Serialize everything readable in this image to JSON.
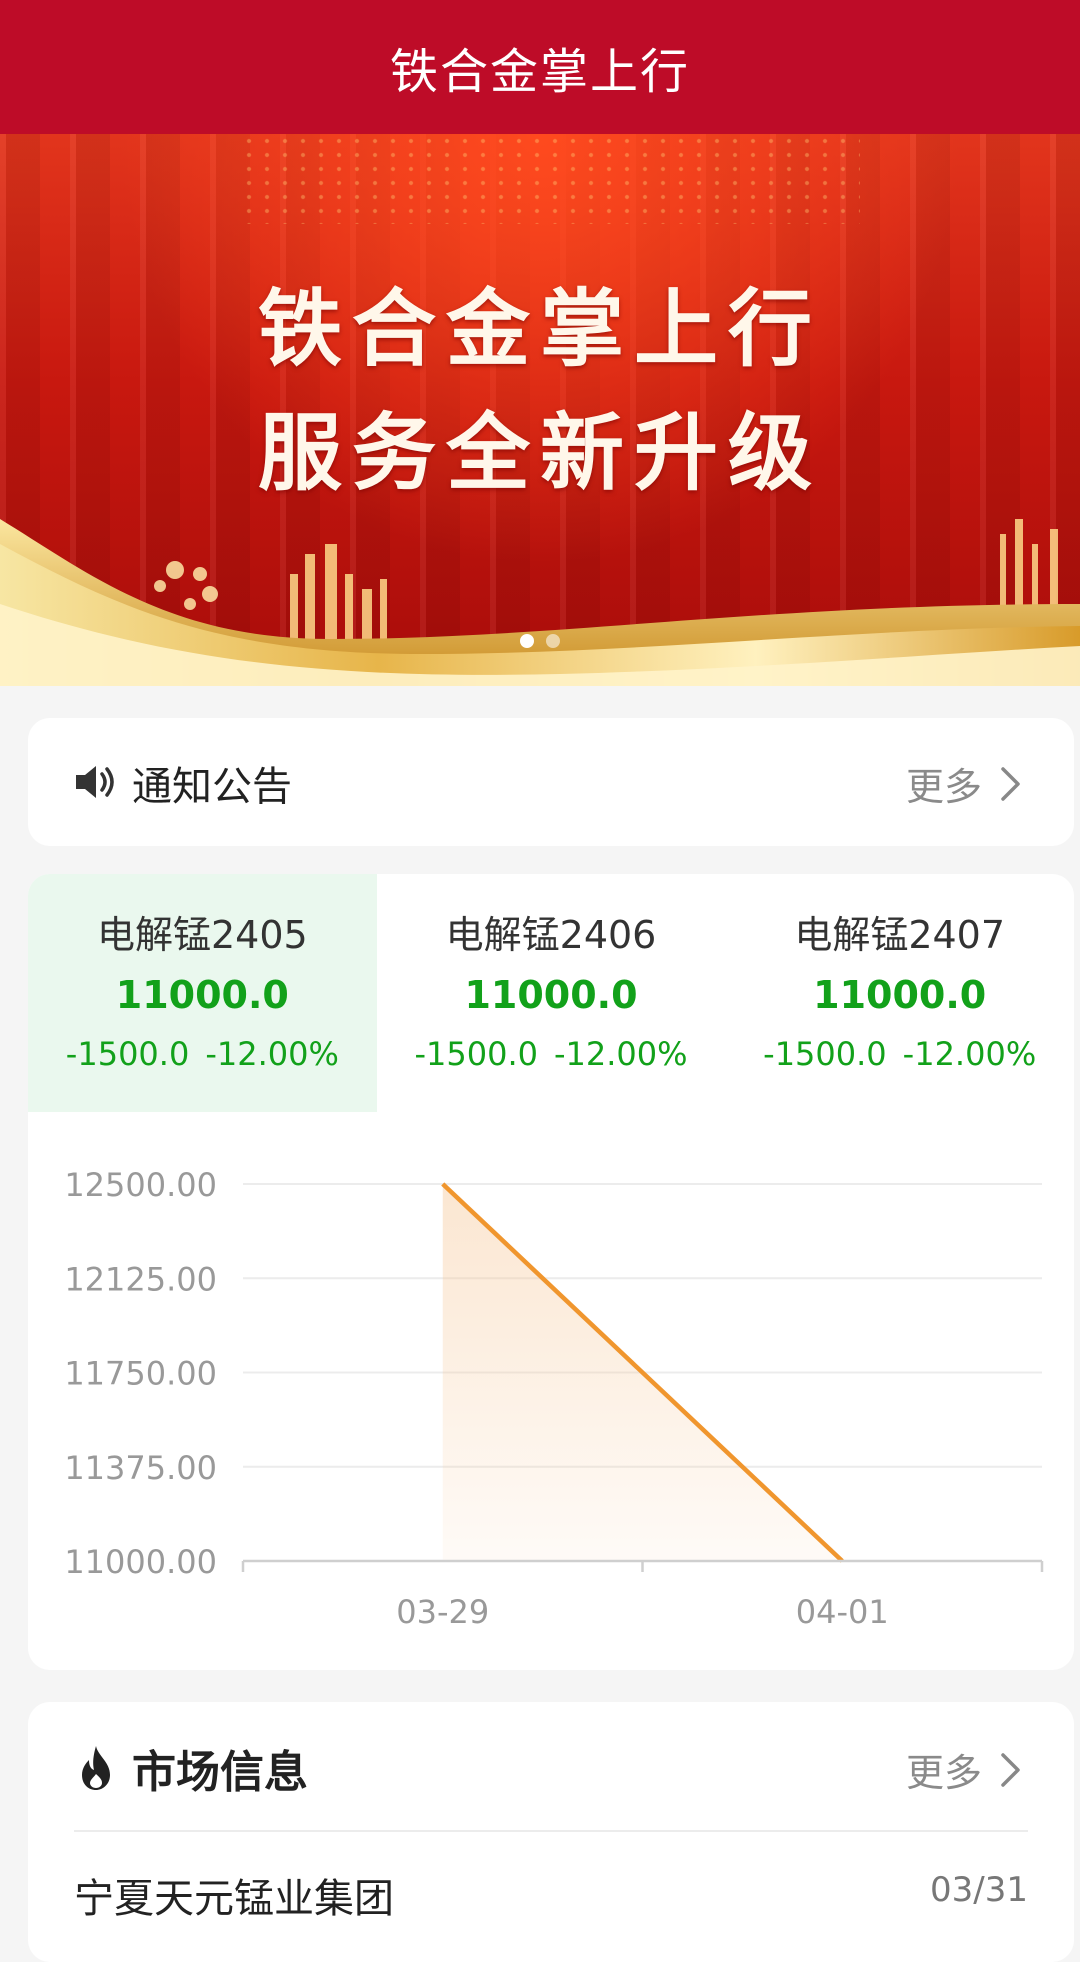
{
  "header": {
    "title": "铁合金掌上行"
  },
  "banner": {
    "line1": "铁合金掌上行",
    "line2": "服务全新升级",
    "slide_count": 2,
    "active_slide": 1
  },
  "notice": {
    "icon": "speaker-icon",
    "title": "通知公告",
    "more_label": "更多"
  },
  "quotes": [
    {
      "name": "电解锰2405",
      "price": "11000.0",
      "change": "-1500.0",
      "change_pct": "-12.00%",
      "selected": true
    },
    {
      "name": "电解锰2406",
      "price": "11000.0",
      "change": "-1500.0",
      "change_pct": "-12.00%",
      "selected": false
    },
    {
      "name": "电解锰2407",
      "price": "11000.0",
      "change": "-1500.0",
      "change_pct": "-12.00%",
      "selected": false
    }
  ],
  "chart_data": {
    "type": "area",
    "x": [
      "03-29",
      "04-01"
    ],
    "values": [
      12500.0,
      11000.0
    ],
    "yticks": [
      "12500.00",
      "12125.00",
      "11750.00",
      "11375.00",
      "11000.00"
    ],
    "ylim": [
      11000,
      12500
    ],
    "grid": true,
    "colors": {
      "line": "#f0962e",
      "fill": "#f6c899",
      "grid": "#ececec",
      "axis": "#cfcfcf",
      "label": "#999999"
    }
  },
  "market": {
    "icon": "fire-icon",
    "title": "市场信息",
    "more_label": "更多",
    "items": [
      {
        "title": "宁夏天元锰业集团",
        "date": "03/31"
      }
    ]
  },
  "colors": {
    "brand": "#be0c28",
    "down": "#12a11a",
    "selected_bg": "#eaf8ee"
  }
}
